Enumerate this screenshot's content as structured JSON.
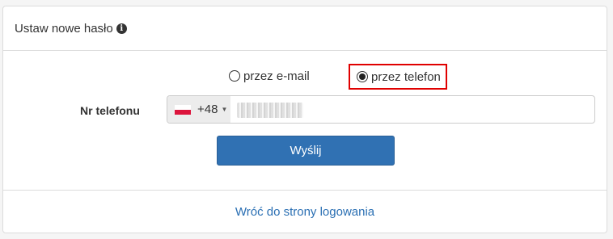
{
  "heading": {
    "title": "Ustaw nowe hasło",
    "info_icon": "info-circle-icon"
  },
  "method": {
    "email_label": "przez e-mail",
    "phone_label": "przez telefon",
    "selected": "phone"
  },
  "phone": {
    "label": "Nr telefonu",
    "country_code": "+48",
    "country_flag": "poland-flag-icon",
    "value_masked": true
  },
  "submit_label": "Wyślij",
  "footer": {
    "back_link": "Wróć do strony logowania"
  },
  "colors": {
    "primary": "#3071b3",
    "link": "#2a6fb3",
    "highlight": "#e00000"
  }
}
